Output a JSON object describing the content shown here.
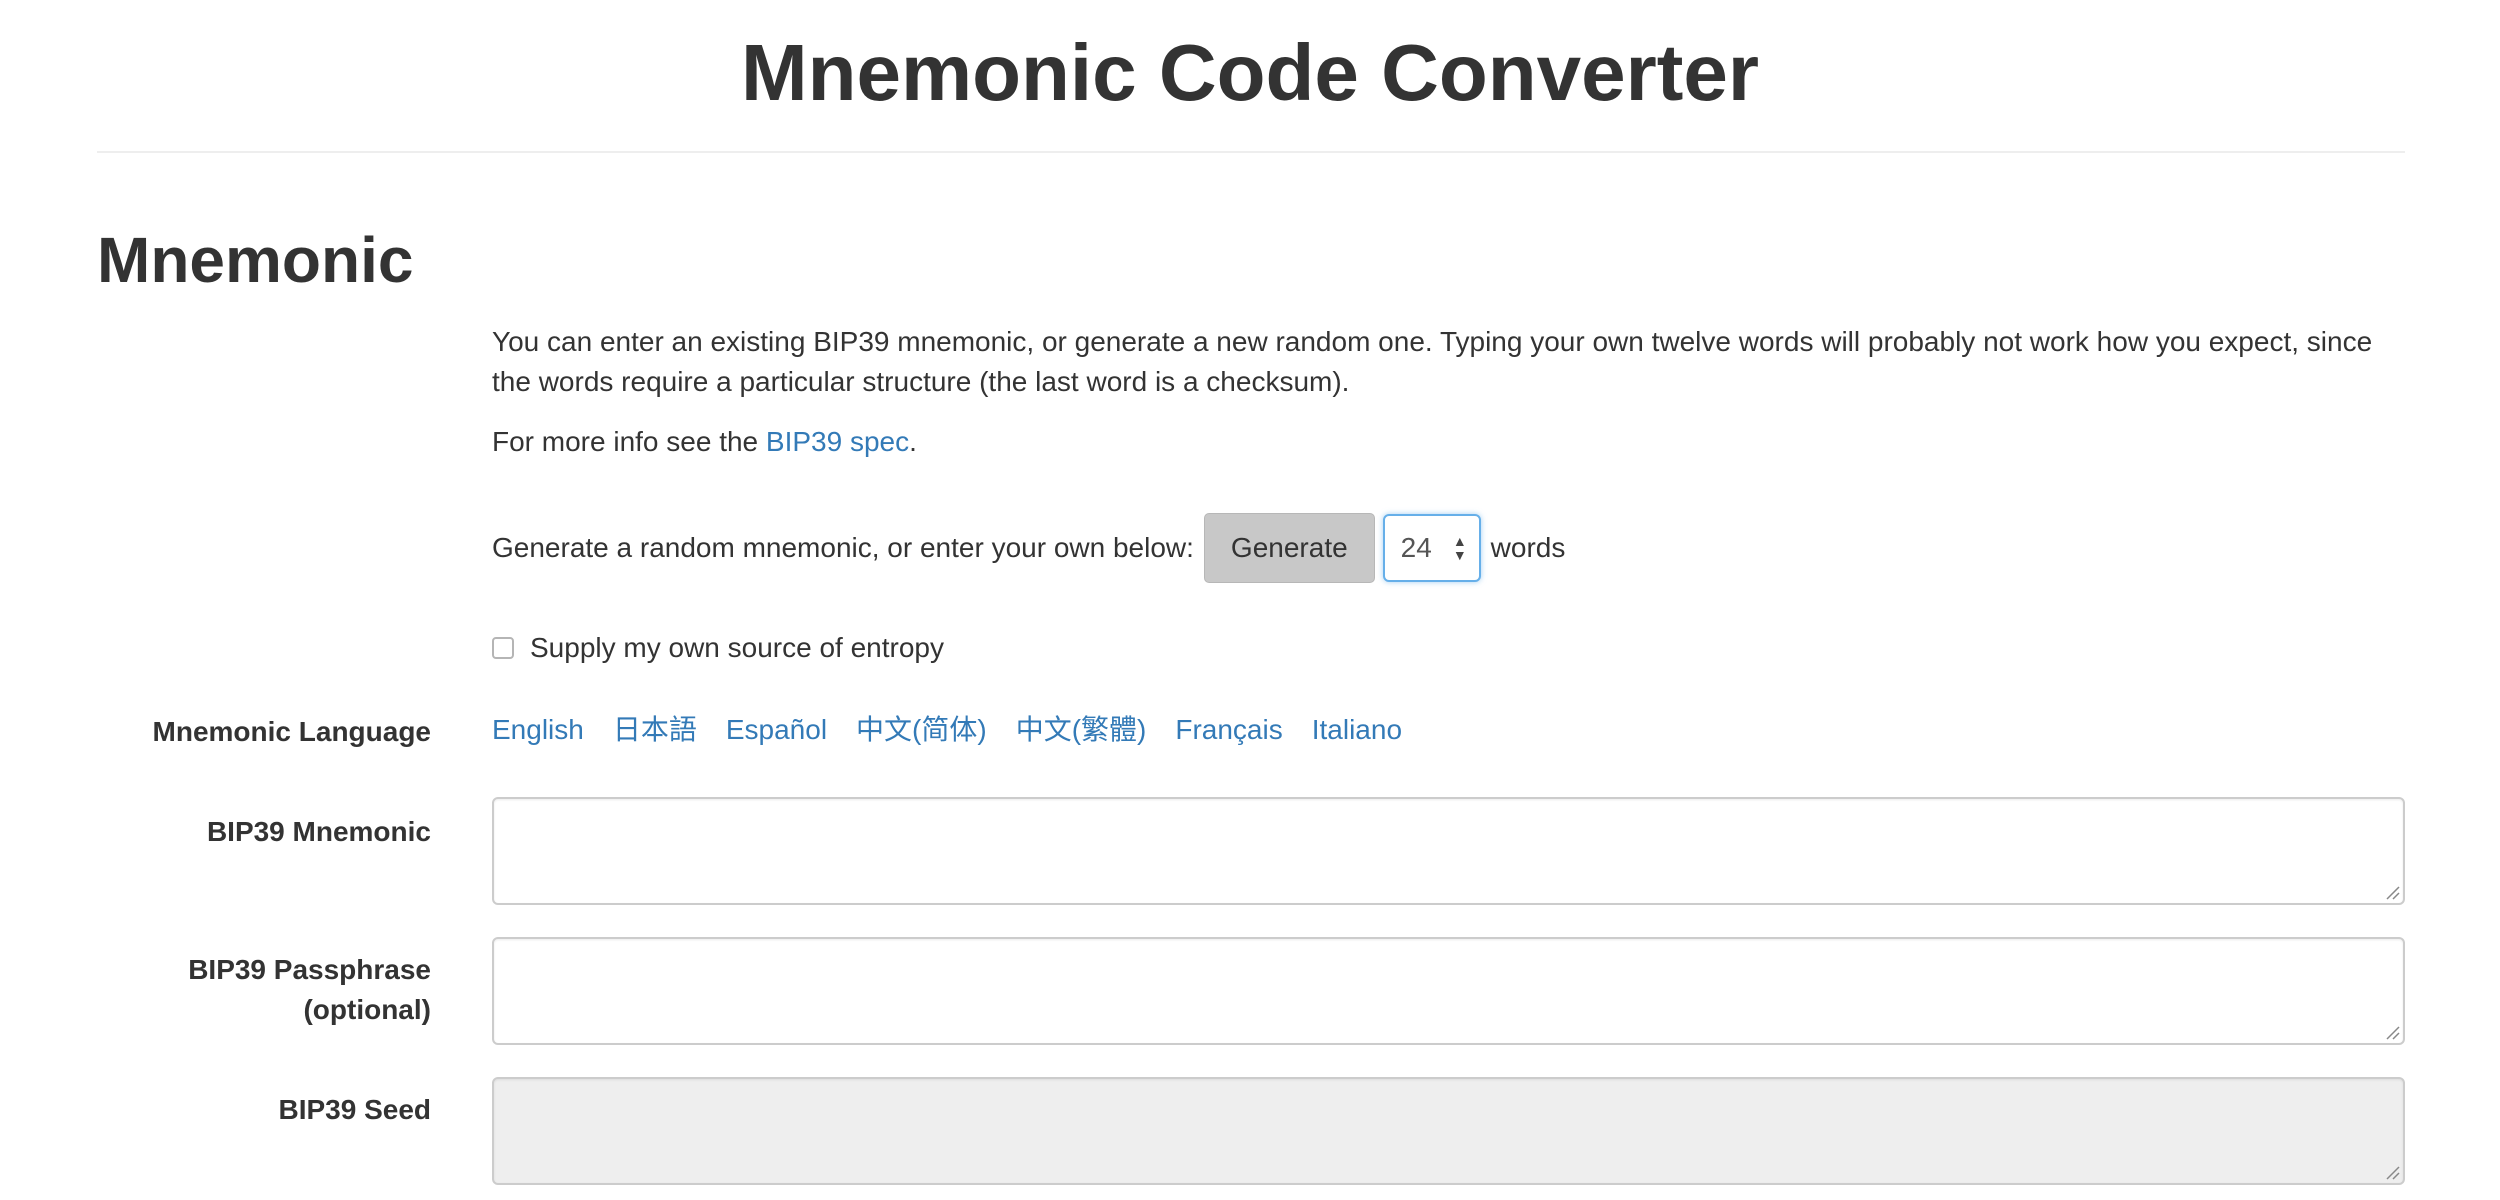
{
  "header": {
    "title": "Mnemonic Code Converter"
  },
  "mnemonic_section": {
    "heading": "Mnemonic",
    "intro": "You can enter an existing BIP39 mnemonic, or generate a new random one. Typing your own twelve words will probably not work how you expect, since the words require a particular structure (the last word is a checksum).",
    "more_info_prefix": "For more info see the",
    "more_info_link": "BIP39 spec",
    "more_info_suffix": ".",
    "generate_prompt": "Generate a random mnemonic, or enter your own below:",
    "generate_label": "Generate",
    "word_count": "24",
    "words_label": "words",
    "entropy_label": "Supply my own source of entropy",
    "entropy_checked": false
  },
  "form": {
    "language_label": "Mnemonic Language",
    "languages": [
      "English",
      "日本語",
      "Español",
      "中文(简体)",
      "中文(繁體)",
      "Français",
      "Italiano"
    ],
    "mnemonic_label": "BIP39 Mnemonic",
    "mnemonic_value": "",
    "passphrase_label_line1": "BIP39 Passphrase",
    "passphrase_label_line2": "(optional)",
    "passphrase_value": "",
    "seed_label": "BIP39 Seed",
    "seed_value": ""
  },
  "colors": {
    "link": "#337ab7",
    "text": "#333333",
    "select_focus": "#66afe9",
    "button_bg": "#c8c8c8",
    "readonly_bg": "#eeeeee"
  }
}
